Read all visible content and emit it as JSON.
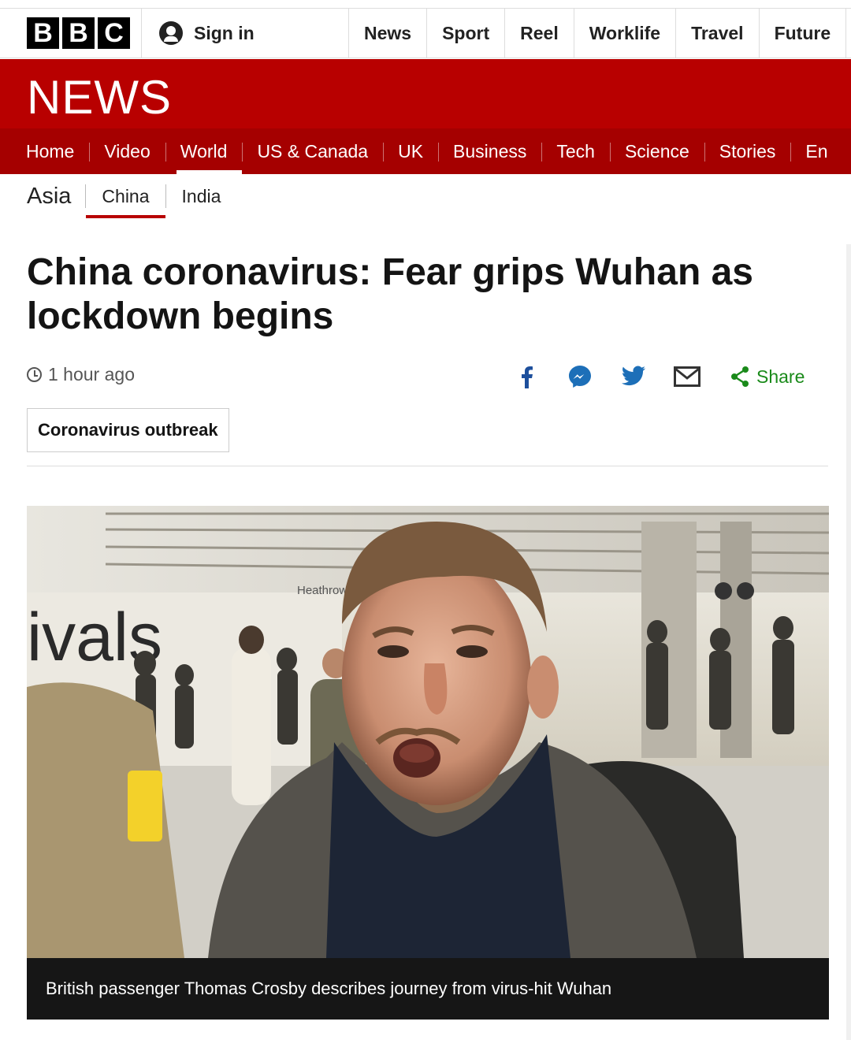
{
  "header": {
    "logo_letters": [
      "B",
      "B",
      "C"
    ],
    "signin_label": "Sign in",
    "nav": [
      "News",
      "Sport",
      "Reel",
      "Worklife",
      "Travel",
      "Future"
    ]
  },
  "news_banner": {
    "title": "NEWS",
    "nav": [
      "Home",
      "Video",
      "World",
      "US & Canada",
      "UK",
      "Business",
      "Tech",
      "Science",
      "Stories",
      "En"
    ],
    "active": "World"
  },
  "section_nav": {
    "title": "Asia",
    "items": [
      "China",
      "India"
    ],
    "active": "China"
  },
  "article": {
    "headline": "China coronavirus: Fear grips Wuhan as lockdown begins",
    "timestamp": "1 hour ago",
    "share_label": "Share",
    "share_icons": [
      "facebook-icon",
      "messenger-icon",
      "twitter-icon",
      "email-icon",
      "share-icon"
    ],
    "topic_tag": "Coronavirus outbreak"
  },
  "media": {
    "caption": "British passenger Thomas Crosby describes journey from virus-hit Wuhan",
    "scene_text": "ivals",
    "sign_text": "Heathrow"
  },
  "colors": {
    "brand_red": "#b80000",
    "subnav_red": "#a50000",
    "share_green": "#1a8a1a",
    "icon_blue": "#1d6fb8"
  }
}
